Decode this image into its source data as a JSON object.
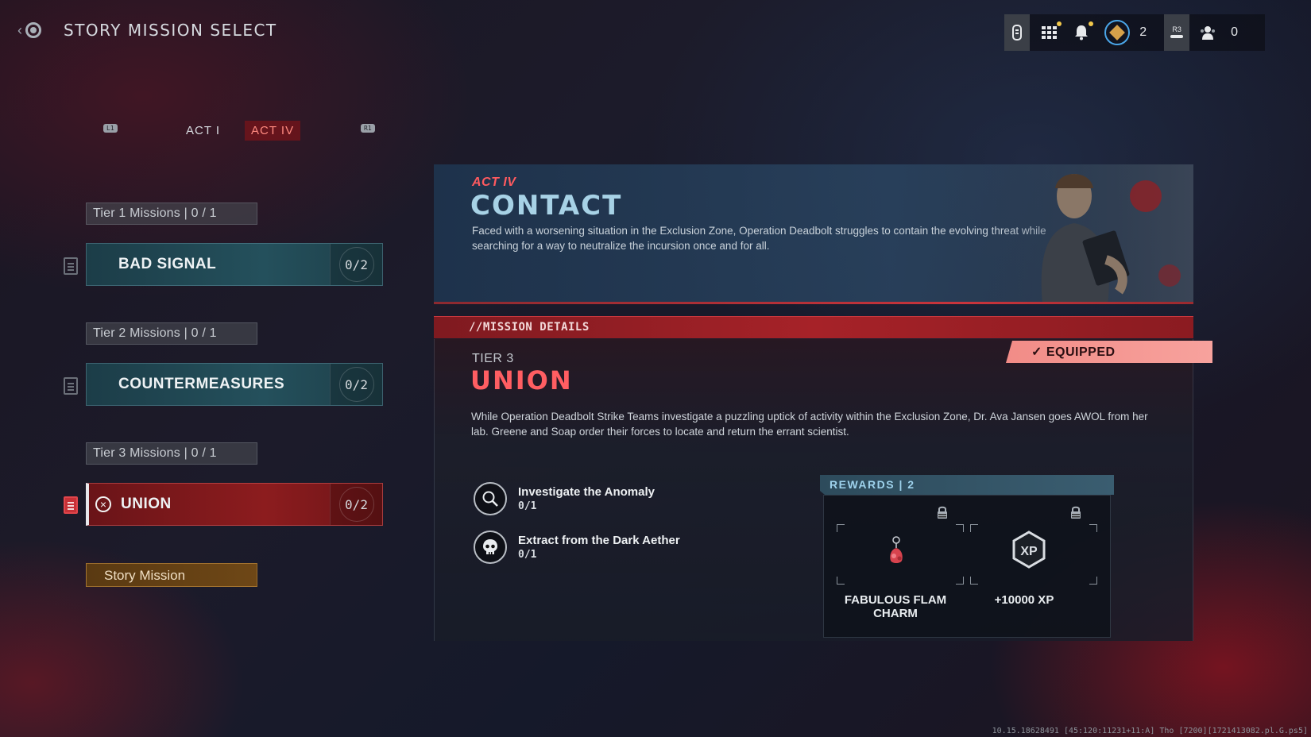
{
  "header": {
    "title": "STORY MISSION SELECT"
  },
  "topbar": {
    "rank_count": "2",
    "r3_label": "R3",
    "party_count": "0"
  },
  "act_tabs": {
    "left_bumper": "L1",
    "right_bumper": "R1",
    "tabs": [
      {
        "label": "ACT I",
        "active": false
      },
      {
        "label": "ACT IV",
        "active": true
      }
    ]
  },
  "mission_list": [
    {
      "tier_label": "Tier 1 Missions | 0 / 1",
      "name": "BAD SIGNAL",
      "progress": "0/2",
      "selected": false
    },
    {
      "tier_label": "Tier 2 Missions | 0 / 1",
      "name": "COUNTERMEASURES",
      "progress": "0/2",
      "selected": false
    },
    {
      "tier_label": "Tier 3 Missions | 0 / 1",
      "name": "UNION",
      "progress": "0/2",
      "selected": true
    }
  ],
  "story_mission_label": "Story Mission",
  "act": {
    "kicker": "ACT IV",
    "title": "CONTACT",
    "description": "Faced with a worsening situation in the Exclusion Zone, Operation Deadbolt struggles to contain the evolving threat while searching for a way to neutralize the incursion once and for all."
  },
  "details": {
    "section_label": "//MISSION DETAILS",
    "equipped_label": "EQUIPPED",
    "tier": "TIER 3",
    "title": "UNION",
    "description": "While Operation Deadbolt Strike Teams investigate a puzzling uptick of activity within the Exclusion Zone, Dr. Ava Jansen goes AWOL from her lab. Greene and Soap order their forces to locate and return the errant scientist.",
    "objectives": [
      {
        "title": "Investigate the Anomaly",
        "progress": "0/1",
        "icon": "magnifier-icon"
      },
      {
        "title": "Extract from the Dark Aether",
        "progress": "0/1",
        "icon": "skull-icon"
      }
    ]
  },
  "rewards": {
    "header": "REWARDS | 2",
    "items": [
      {
        "name": "FABULOUS FLAM CHARM",
        "icon": "charm-icon",
        "locked": true
      },
      {
        "name": "+10000 XP",
        "icon": "xp-badge-icon",
        "badge_text": "XP",
        "locked": true
      }
    ]
  },
  "debug_text": "10.15.18628491 [45:120:11231+11:A] Tho [7200][1721413082.pl.G.ps5]",
  "colors": {
    "accent_red": "#ff5e62",
    "title_blue": "#a7d2e6",
    "equipped_pink": "#f28c87",
    "rewards_blue": "#9ed2ec"
  }
}
